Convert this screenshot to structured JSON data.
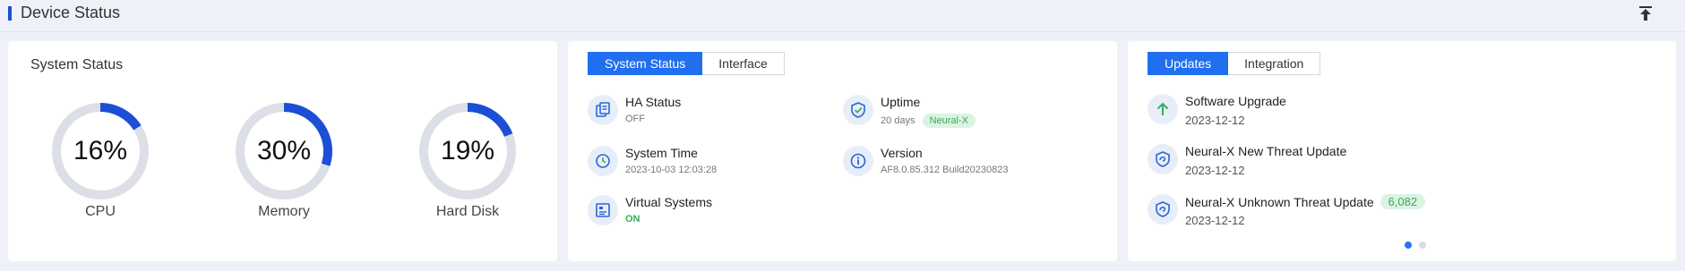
{
  "header": {
    "title": "Device Status"
  },
  "system_status": {
    "title": "System Status",
    "gauges": [
      {
        "label": "CPU",
        "percent_text": "16%",
        "value": 16
      },
      {
        "label": "Memory",
        "percent_text": "30%",
        "value": 30
      },
      {
        "label": "Hard Disk",
        "percent_text": "19%",
        "value": 19
      }
    ]
  },
  "overview": {
    "tabs": [
      {
        "label": "System Status"
      },
      {
        "label": "Interface"
      }
    ],
    "items": [
      {
        "title": "HA Status",
        "value": "OFF"
      },
      {
        "title": "Uptime",
        "value": "20 days",
        "badge": "Neural-X"
      },
      {
        "title": "System Time",
        "value": "2023-10-03 12:03:28"
      },
      {
        "title": "Version",
        "value": "AF8.0.85.312 Build20230823"
      },
      {
        "title": "Virtual Systems",
        "value": "ON"
      }
    ]
  },
  "updates": {
    "tabs": [
      {
        "label": "Updates"
      },
      {
        "label": "Integration"
      }
    ],
    "items": [
      {
        "title": "Software Upgrade",
        "date": "2023-12-12"
      },
      {
        "title": "Neural-X New Threat Update",
        "date": "2023-12-12"
      },
      {
        "title": "Neural-X Unknown Threat Update",
        "date": "2023-12-12",
        "badge": "6,082"
      }
    ]
  },
  "colors": {
    "accent": "#1f6ff0",
    "gauge_fill": "#1c4fd6",
    "gauge_track": "#dcdfe6",
    "status_green": "#35b05c"
  }
}
